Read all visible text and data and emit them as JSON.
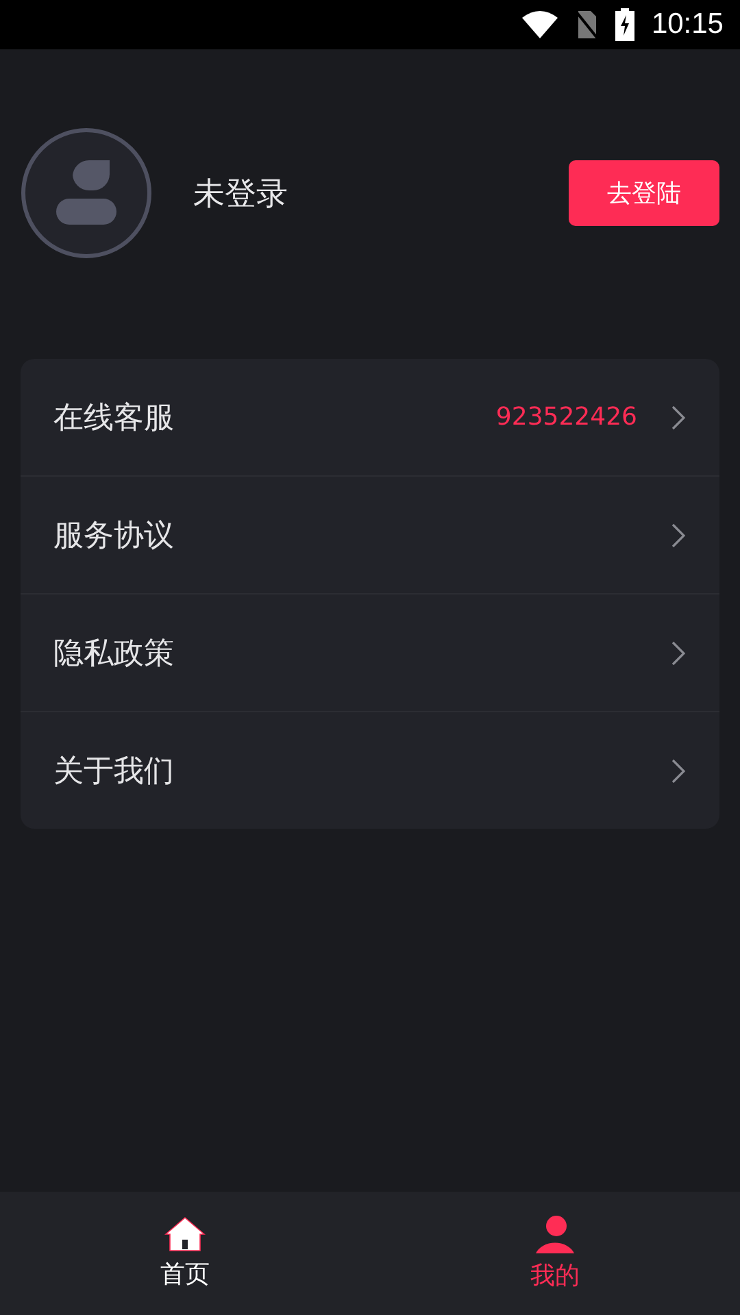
{
  "status_bar": {
    "time": "10:15"
  },
  "profile": {
    "name": "未登录",
    "login_button": "去登陆"
  },
  "menu": [
    {
      "label": "在线客服",
      "value": "923522426"
    },
    {
      "label": "服务协议"
    },
    {
      "label": "隐私政策"
    },
    {
      "label": "关于我们"
    }
  ],
  "tabs": [
    {
      "label": "首页",
      "selected": false
    },
    {
      "label": "我的",
      "selected": true
    }
  ]
}
